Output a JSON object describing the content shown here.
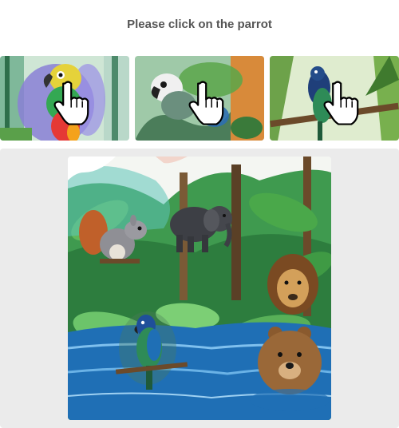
{
  "prompt": {
    "text": "Please click on the parrot"
  },
  "examples": [
    {
      "subject": "parrot",
      "cursor_icon": "hand-pointer-icon"
    },
    {
      "subject": "parrot",
      "cursor_icon": "hand-pointer-icon"
    },
    {
      "subject": "parrot",
      "cursor_icon": "hand-pointer-icon"
    }
  ],
  "scene": {
    "animals": [
      "squirrel",
      "elephant",
      "lion",
      "parrot",
      "bear"
    ],
    "target": "parrot"
  },
  "colors": {
    "prompt_text": "#555555",
    "panel_bg": "#ebebeb",
    "water": "#1f6fb5",
    "jungle_green": "#2f8a3a"
  }
}
